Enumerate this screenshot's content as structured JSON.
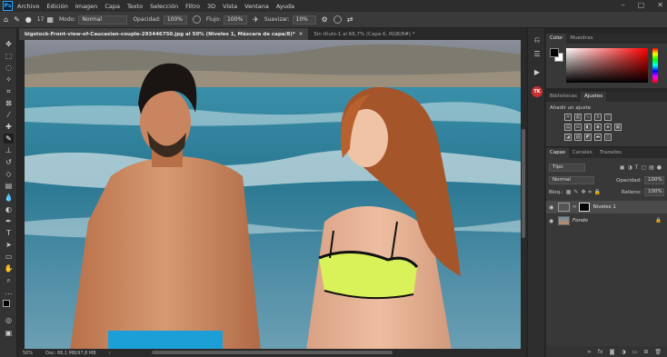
{
  "menu": [
    "Archivo",
    "Edición",
    "Imagen",
    "Capa",
    "Texto",
    "Selección",
    "Filtro",
    "3D",
    "Vista",
    "Ventana",
    "Ayuda"
  ],
  "options": {
    "brush_size": "17",
    "mode_label": "Modo:",
    "mode_value": "Normal",
    "opacity_label": "Opacidad:",
    "opacity_value": "100%",
    "flow_label": "Flujo:",
    "flow_value": "100%",
    "smoothing_label": "Suavizar:",
    "smoothing_value": "10%"
  },
  "tabs": [
    {
      "label": "bigstock-Front-view-of-Caucasian-couple-293446750.jpg al 50% (Niveles 1, Máscara de capa/8)*",
      "active": true
    },
    {
      "label": "Sin título-1 al 66,7% (Capa 6, RGB/8#) *",
      "active": false
    }
  ],
  "status": {
    "zoom": "50%",
    "doc": "Doc: 86,1 MB/97,8 MB"
  },
  "color_panel": {
    "tabs": [
      "Color",
      "Muestras"
    ],
    "fg": "#000000",
    "bg": "#ffffff"
  },
  "adjust_panel": {
    "tabs": [
      "Bibliotecas",
      "Ajustes"
    ],
    "title": "Añadir un ajuste"
  },
  "layers_panel": {
    "tabs": [
      "Capas",
      "Canales",
      "Trazados"
    ],
    "filter": "Tipo",
    "blend": "Normal",
    "opacity_label": "Opacidad:",
    "opacity_value": "100%",
    "lock_label": "Bloq.:",
    "fill_label": "Relleno:",
    "fill_value": "100%",
    "layers": [
      {
        "name": "Niveles 1",
        "selected": true
      },
      {
        "name": "Fondo",
        "selected": false
      }
    ]
  },
  "icons": {
    "toolbar": [
      "move-icon",
      "marquee-icon",
      "lasso-icon",
      "quick-select-icon",
      "crop-icon",
      "frame-icon",
      "eyedropper-icon",
      "healing-icon",
      "brush-icon",
      "stamp-icon",
      "history-brush-icon",
      "eraser-icon",
      "gradient-icon",
      "blur-icon",
      "dodge-icon",
      "pen-icon",
      "type-icon",
      "path-select-icon",
      "shape-icon",
      "hand-icon",
      "zoom-icon",
      "more-icon"
    ]
  }
}
